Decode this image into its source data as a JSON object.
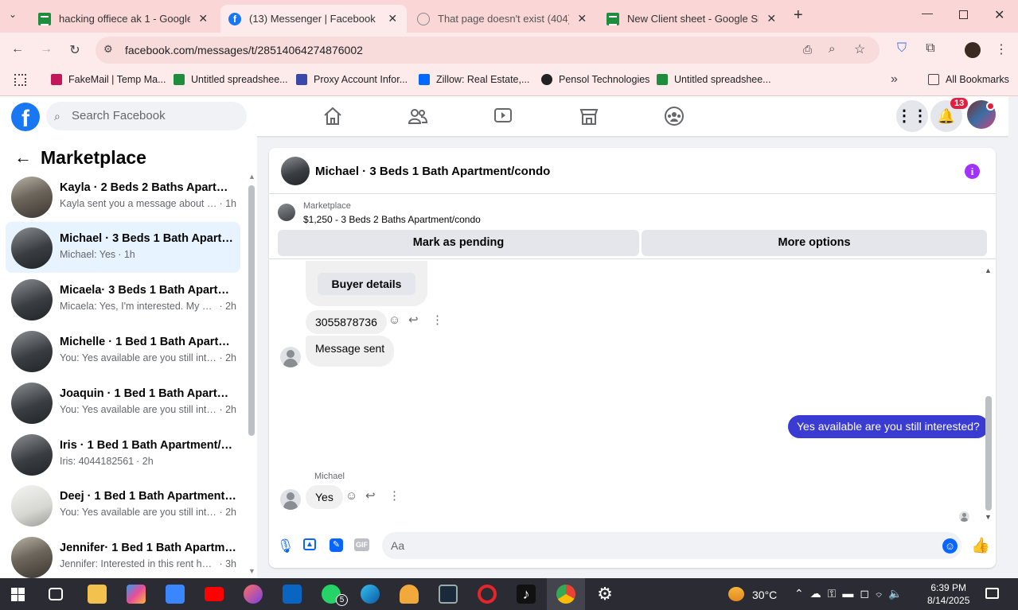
{
  "browser": {
    "tabs": [
      {
        "title": "hacking offiece ak 1 - Google Sh",
        "icon": "sheets-icon",
        "active": false
      },
      {
        "title": "(13) Messenger | Facebook",
        "icon": "facebook-icon",
        "active": true
      },
      {
        "title": "That page doesn't exist (404) -",
        "icon": "globe-icon",
        "active": false
      },
      {
        "title": "New Client sheet - Google Shee",
        "icon": "sheets-icon",
        "active": false
      }
    ],
    "url": "facebook.com/messages/t/28514064274876002",
    "bookmarks": [
      {
        "label": "FakeMail | Temp Ma...",
        "color": "#c2185b"
      },
      {
        "label": "Untitled spreadshee...",
        "color": "#1e8e3e"
      },
      {
        "label": "Proxy Account Infor...",
        "color": "#3949ab"
      },
      {
        "label": "Zillow: Real Estate,...",
        "color": "#006aff"
      },
      {
        "label": "Pensol Technologies",
        "color": "#222222"
      },
      {
        "label": "Untitled spreadshee...",
        "color": "#1e8e3e"
      }
    ],
    "all_bookmarks": "All Bookmarks"
  },
  "facebook": {
    "logo": "f",
    "search_placeholder": "Search Facebook",
    "notification_count": "13"
  },
  "sidebar": {
    "title": "Marketplace",
    "conversations": [
      {
        "name": "Kayla · 2 Beds 2 Baths Apartme...",
        "preview": "Kayla sent you a message about yo...",
        "time": "· 1h",
        "selected": false
      },
      {
        "name": "Michael · 3 Beds 1 Bath Apartme...",
        "preview": "Michael: Yes",
        "time": "· 1h",
        "selected": true
      },
      {
        "name": "Micaela· 3 Beds 1 Bath Apartme...",
        "preview": "Micaela: Yes, I'm interested. My nu...",
        "time": "· 2h",
        "selected": false
      },
      {
        "name": "Michelle · 1 Bed 1 Bath Apartme...",
        "preview": "You: Yes available are you still inter...",
        "time": "· 2h",
        "selected": false
      },
      {
        "name": "Joaquin · 1 Bed 1 Bath Apartmen...",
        "preview": "You: Yes available are you still inter...",
        "time": "· 2h",
        "selected": false
      },
      {
        "name": "Iris · 1 Bed 1 Bath Apartment/co...",
        "preview": "Iris: 4044182561",
        "time": "· 2h",
        "selected": false
      },
      {
        "name": "Deej · 1 Bed 1 Bath Apartment/c...",
        "preview": "You: Yes available are you still inter...",
        "time": "· 2h",
        "selected": false
      },
      {
        "name": "Jennifer· 1 Bed 1 Bath Apartmen...",
        "preview": "Jennifer: Interested in this rent hou...",
        "time": "· 3h",
        "selected": false
      }
    ]
  },
  "chat": {
    "title": "Michael · 3 Beds 1 Bath Apartment/condo",
    "marketplace_label": "Marketplace",
    "listing": "$1,250 - 3 Beds 2 Baths Apartment/condo",
    "mark_pending": "Mark as pending",
    "more_options": "More options",
    "buyer_details": "Buyer details",
    "phone_message": "3055878736",
    "system_message": "Message sent",
    "my_message": "Yes available are you still interested?",
    "sender_name": "Michael",
    "reply": "Yes",
    "composer_placeholder": "Aa"
  },
  "taskbar": {
    "temperature": "30°C",
    "time": "6:39 PM",
    "date": "8/14/2025",
    "whatsapp_badge": "5"
  }
}
